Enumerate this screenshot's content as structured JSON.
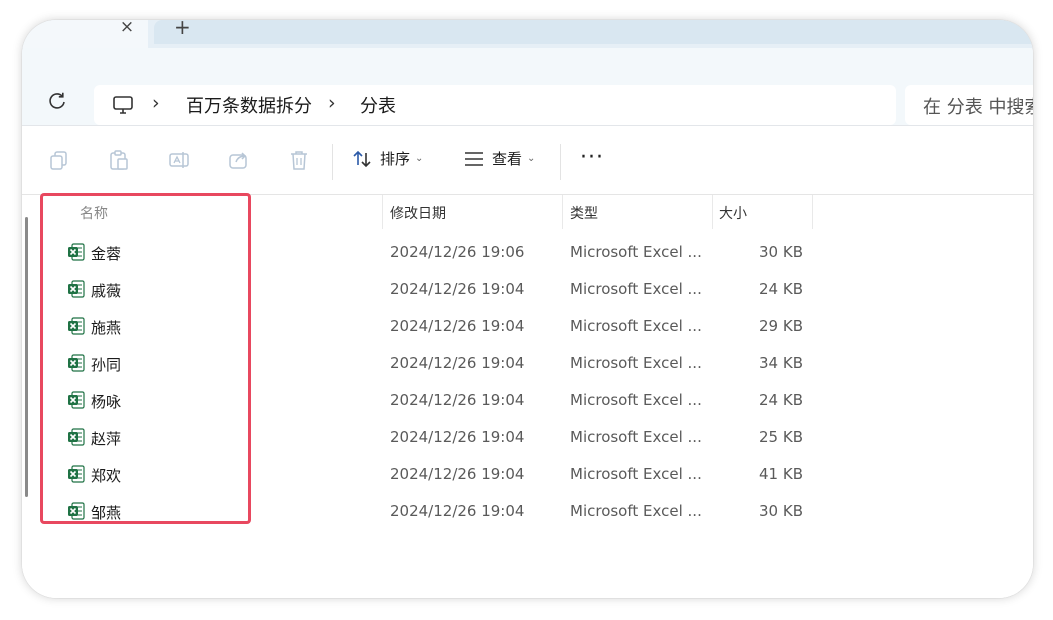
{
  "tabs": {
    "close_glyph": "×",
    "new_tab_glyph": "+"
  },
  "address": {
    "breadcrumbs": [
      "百万条数据拆分",
      "分表"
    ],
    "search_placeholder": "在 分表 中搜索"
  },
  "toolbar": {
    "sort_label": "排序",
    "view_label": "查看",
    "more_label": "···",
    "icons": [
      "copy-icon",
      "paste-icon",
      "rename-icon",
      "share-icon",
      "delete-icon"
    ]
  },
  "columns": {
    "name": "名称",
    "modified": "修改日期",
    "type": "类型",
    "size": "大小"
  },
  "files": [
    {
      "name": "金蓉",
      "modified": "2024/12/26 19:06",
      "type": "Microsoft Excel ...",
      "size": "30 KB"
    },
    {
      "name": "戚薇",
      "modified": "2024/12/26 19:04",
      "type": "Microsoft Excel ...",
      "size": "24 KB"
    },
    {
      "name": "施燕",
      "modified": "2024/12/26 19:04",
      "type": "Microsoft Excel ...",
      "size": "29 KB"
    },
    {
      "name": "孙同",
      "modified": "2024/12/26 19:04",
      "type": "Microsoft Excel ...",
      "size": "34 KB"
    },
    {
      "name": "杨咏",
      "modified": "2024/12/26 19:04",
      "type": "Microsoft Excel ...",
      "size": "24 KB"
    },
    {
      "name": "赵萍",
      "modified": "2024/12/26 19:04",
      "type": "Microsoft Excel ...",
      "size": "25 KB"
    },
    {
      "name": "郑欢",
      "modified": "2024/12/26 19:04",
      "type": "Microsoft Excel ...",
      "size": "41 KB"
    },
    {
      "name": "邹燕",
      "modified": "2024/12/26 19:04",
      "type": "Microsoft Excel ...",
      "size": "30 KB"
    }
  ],
  "colors": {
    "highlight": "#e8485f",
    "excel_green": "#1f7244",
    "address_bg": "#f3f8fb"
  }
}
